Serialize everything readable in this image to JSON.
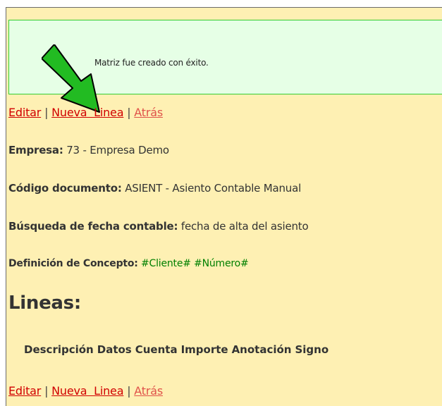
{
  "notice": {
    "message": "Matriz fue creado con éxito."
  },
  "actions": {
    "edit_label": "Editar",
    "separator": "|",
    "new_line_label": "Nueva  Linea",
    "back_label": "Atrás"
  },
  "fields": {
    "empresa": {
      "label": "Empresa:",
      "value": "73 - Empresa Demo"
    },
    "codigo_documento": {
      "label": "Código documento:",
      "value": "ASIENT - Asiento Contable Manual"
    },
    "busqueda_fecha": {
      "label": "Búsqueda de fecha contable:",
      "value": "fecha de alta del asiento"
    },
    "definicion_concepto": {
      "label": "Definición de Concepto:",
      "value_parts": [
        "#Cliente#",
        "#Número#"
      ]
    }
  },
  "lineas": {
    "title": "Lineas:",
    "columns": [
      "Descripción",
      "Datos",
      "Cuenta",
      "Importe",
      "Anotación",
      "Signo"
    ]
  },
  "colors": {
    "page_background": "#fef0b3",
    "notice_background": "#e6ffe6",
    "notice_border": "#32cd32",
    "link": "#d10000",
    "link_visited": "#e0524a",
    "concept_variable": "#008000",
    "arrow_fill": "#22bb22"
  },
  "icons": {
    "annotation_arrow": "green-arrow-icon"
  }
}
